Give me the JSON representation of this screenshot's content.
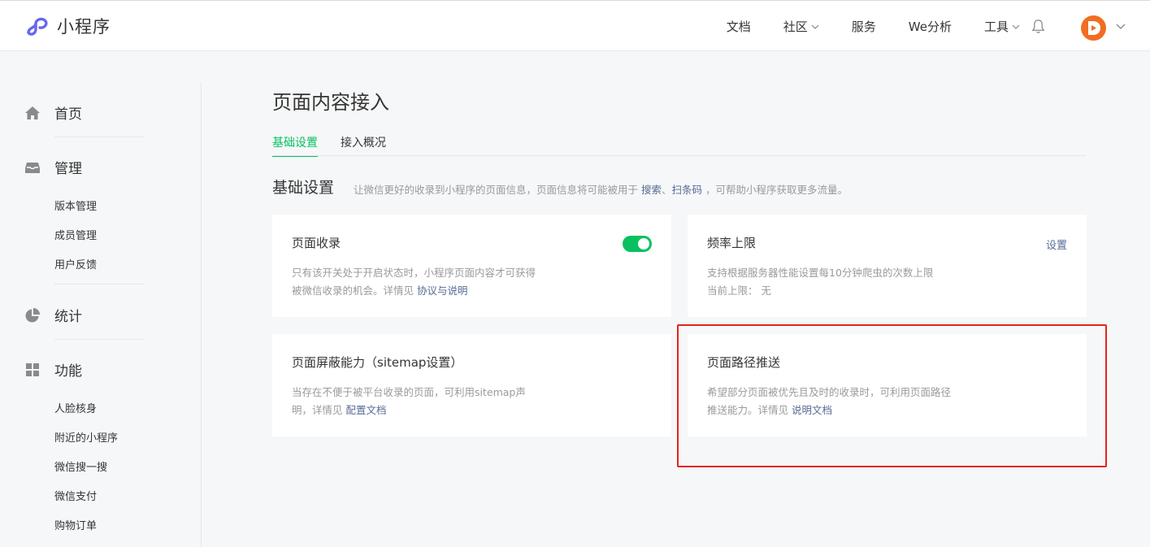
{
  "header": {
    "app_name": "小程序",
    "nav": [
      "文档",
      "社区",
      "服务",
      "We分析",
      "工具"
    ],
    "nav_has_dropdown": [
      false,
      true,
      false,
      false,
      true
    ],
    "icons": [
      "bell-icon",
      "avatar",
      "chevron-down-icon"
    ]
  },
  "sidebar": {
    "sections": [
      {
        "label": "首页",
        "icon": "home-icon"
      },
      {
        "label": "管理",
        "icon": "inbox-icon",
        "items": [
          "版本管理",
          "成员管理",
          "用户反馈"
        ]
      },
      {
        "label": "统计",
        "icon": "pie-chart-icon"
      },
      {
        "label": "功能",
        "icon": "grid-icon",
        "items": [
          "人脸核身",
          "附近的小程序",
          "微信搜一搜",
          "微信支付",
          "购物订单"
        ]
      }
    ]
  },
  "main": {
    "title": "页面内容接入",
    "tabs": [
      "基础设置",
      "接入概况"
    ],
    "section": {
      "title": "基础设置",
      "desc_pre": "让微信更好的收录到小程序的页面信息，页面信息将可能被用于 ",
      "desc_link1": "搜索",
      "desc_sep": "、",
      "desc_link2": "扫条码",
      "desc_post": " ，可帮助小程序获取更多流量。"
    },
    "cards": [
      {
        "title": "页面收录",
        "desc_line1": "只有该开关处于开启状态时，小程序页面内容才可获得",
        "desc_line2": "被微信收录的机会。详情见 ",
        "link": "协议与说明",
        "toggle_on": true
      },
      {
        "title": "频率上限",
        "desc_line1": "支持根据服务器性能设置每10分钟爬虫的次数上限",
        "desc_line2": "当前上限： 无",
        "action": "设置"
      },
      {
        "title": "页面屏蔽能力（sitemap设置）",
        "desc_line1": "当存在不便于被平台收录的页面，可利用sitemap声",
        "desc_line2": "明，详情见 ",
        "link": "配置文档"
      },
      {
        "title": "页面路径推送",
        "desc_line1": "希望部分页面被优先且及时的收录时，可利用页面路径",
        "desc_line2": "推送能力。详情见 ",
        "link": "说明文档"
      }
    ]
  },
  "colors": {
    "accent_green": "#07c160",
    "link_blue": "#576b95",
    "highlight_red": "#e5231d",
    "logo_purple": "#6467f0",
    "avatar_orange": "#f26d21"
  }
}
